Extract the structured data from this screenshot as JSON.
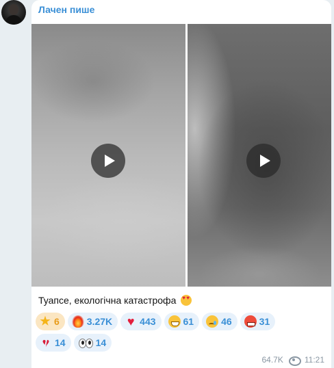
{
  "post": {
    "channel_name": "Лачен пише",
    "caption": "Туапсе, екологічна катастрофа",
    "caption_emoji": "heart-eyes-emoji",
    "views": "64.7K",
    "time": "11:21"
  },
  "reactions": {
    "row1": [
      {
        "icon": "star-icon",
        "count": "6"
      },
      {
        "icon": "fire-icon",
        "count": "3.27K"
      },
      {
        "icon": "heart-icon",
        "count": "443"
      },
      {
        "icon": "grin-face-icon",
        "count": "61"
      },
      {
        "icon": "crying-face-icon",
        "count": "46"
      },
      {
        "icon": "angry-face-icon",
        "count": "31"
      }
    ],
    "row2": [
      {
        "icon": "broken-heart-icon",
        "count": "14"
      },
      {
        "icon": "eyes-icon",
        "count": "14"
      }
    ]
  },
  "colors": {
    "accent": "#3a8fd6",
    "reaction_bg": "#e7f1fb",
    "star_reaction_bg": "#fbe6c2",
    "page_bg": "#e8eef2"
  }
}
